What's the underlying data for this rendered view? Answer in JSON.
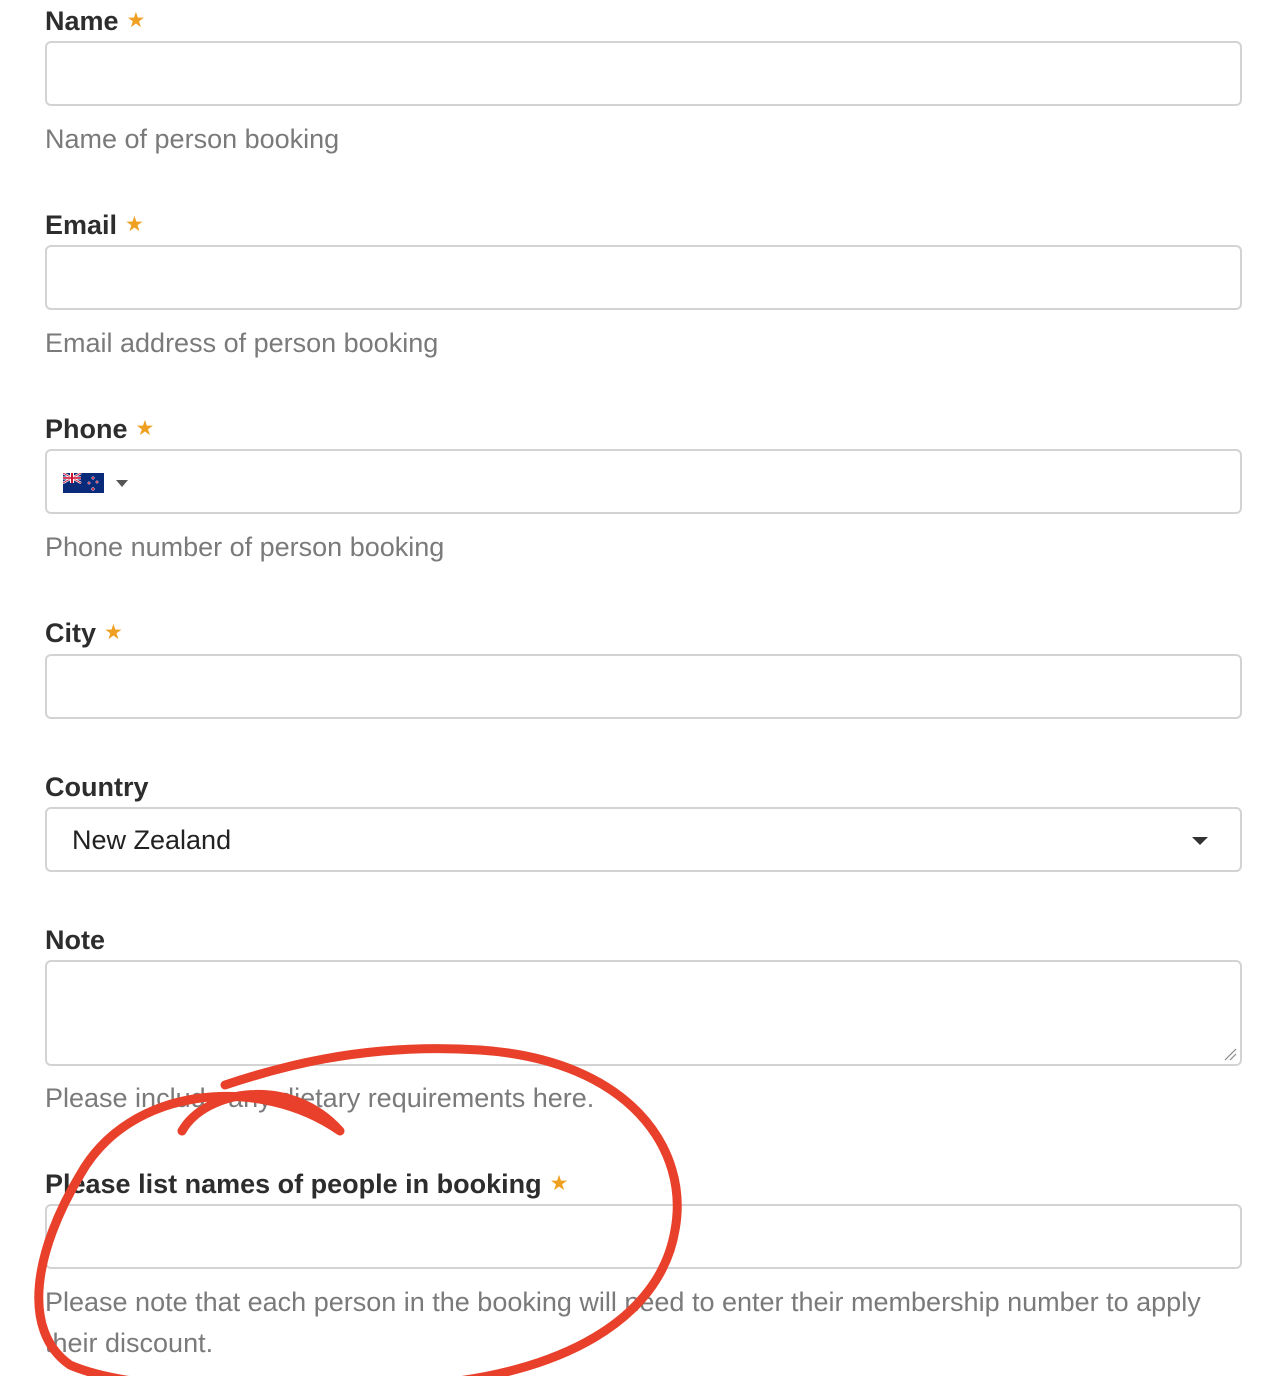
{
  "form": {
    "name": {
      "label": "Name",
      "required_mark": "★",
      "value": "",
      "help": "Name of person booking"
    },
    "email": {
      "label": "Email",
      "required_mark": "★",
      "value": "",
      "help": "Email address of person booking"
    },
    "phone": {
      "label": "Phone",
      "required_mark": "★",
      "country_flag_icon": "new-zealand-flag-icon",
      "value": "",
      "help": "Phone number of person booking"
    },
    "city": {
      "label": "City",
      "required_mark": "★",
      "value": ""
    },
    "country": {
      "label": "Country",
      "selected": "New Zealand"
    },
    "note": {
      "label": "Note",
      "value": "",
      "help": "Please include any dietary requirements here."
    },
    "people": {
      "label": "Please list names of people in booking",
      "required_mark": "★",
      "value": "",
      "help": "Please note that each person in the booking will need to enter their membership number to apply their discount."
    }
  },
  "colors": {
    "required_star": "#f0a020",
    "annotation_stroke": "#e8402a",
    "help_text": "#7a7a7a",
    "field_border": "#d3d3d3"
  },
  "annotation": {
    "shape": "hand-drawn-loop",
    "around": "people"
  }
}
